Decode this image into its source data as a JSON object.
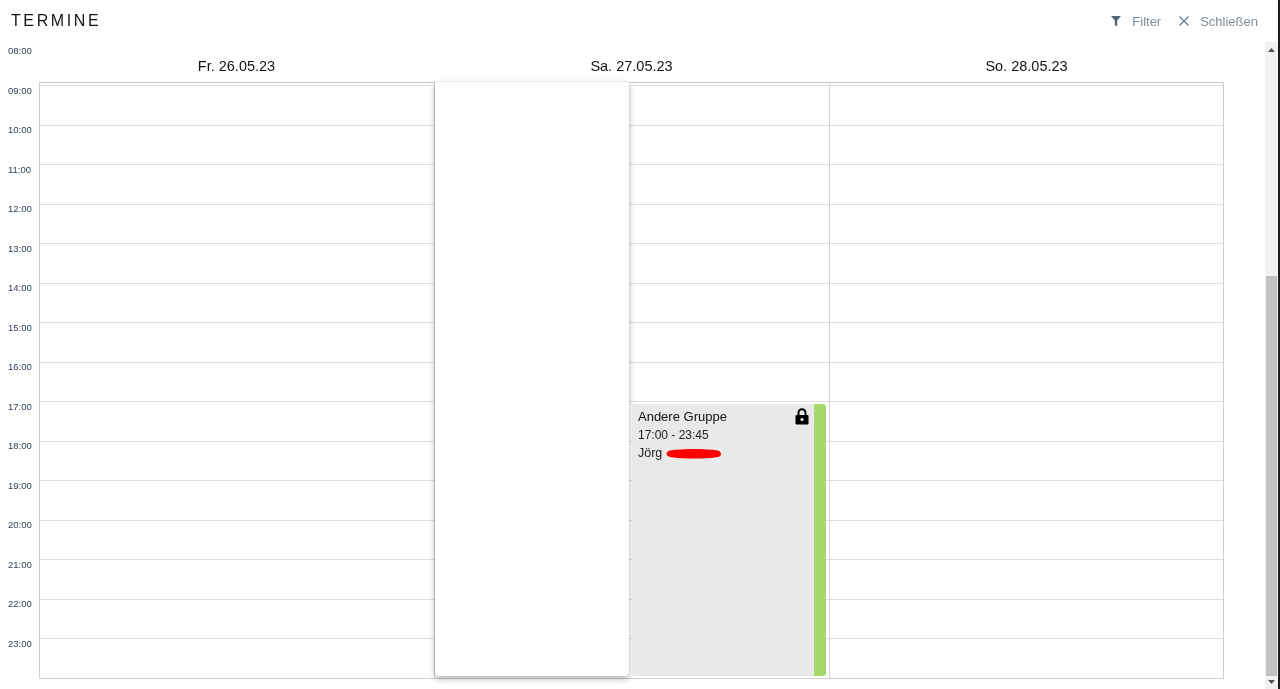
{
  "header": {
    "title": "TERMINE",
    "actions": [
      {
        "kind": "filter",
        "label": "Filter"
      },
      {
        "kind": "close",
        "label": "Schließen"
      }
    ]
  },
  "calendar": {
    "hours": [
      "08:00",
      "09:00",
      "10:00",
      "11:00",
      "12:00",
      "13:00",
      "14:00",
      "15:00",
      "16:00",
      "17:00",
      "18:00",
      "19:00",
      "20:00",
      "21:00",
      "22:00",
      "23:00"
    ],
    "days": [
      {
        "label": "Fr. 26.05.23"
      },
      {
        "label": "Sa. 27.05.23",
        "events": [
          {
            "kind": "blank"
          },
          {
            "kind": "appointment",
            "title": "Andere Gruppe",
            "time": "17:00 - 23:45",
            "person": "Jörg",
            "person_redacted": true,
            "locked": true,
            "color": "#a8d86b"
          }
        ]
      },
      {
        "label": "So. 28.05.23"
      }
    ]
  }
}
